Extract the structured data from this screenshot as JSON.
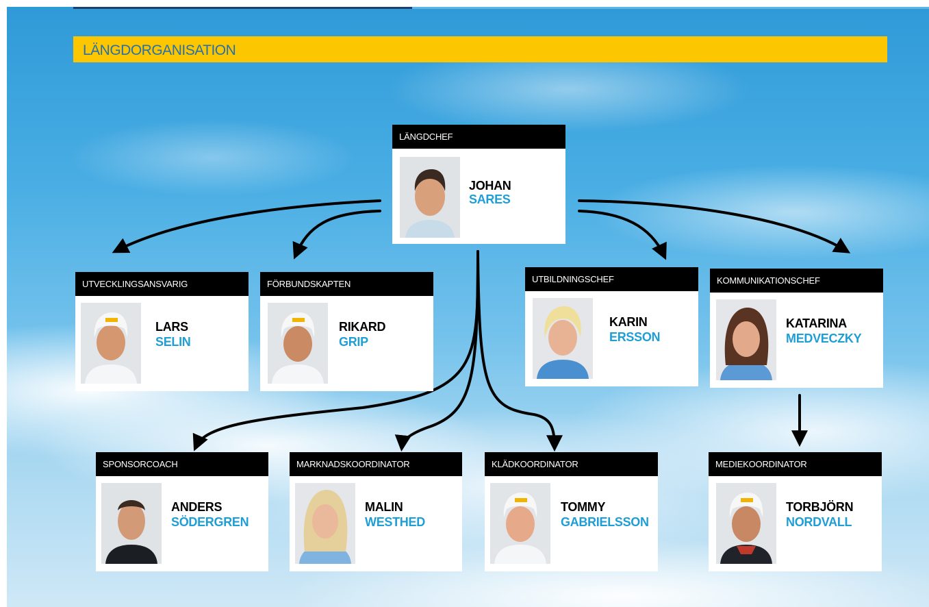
{
  "title": "LÄNGDORGANISATION",
  "colors": {
    "title_bar": "#fcc600",
    "title_text": "#2a6fa8",
    "card_header": "#000000",
    "first_name": "#000000",
    "last_name": "#1f9ed6"
  },
  "head": {
    "role": "LÄNGDCHEF",
    "first": "JOHAN",
    "last": "SARES",
    "photo": "portrait-photo"
  },
  "row1": [
    {
      "role": "UTVECKLINGSANSVARIG",
      "first": "LARS",
      "last": "SELIN",
      "photo": "portrait-photo"
    },
    {
      "role": "FÖRBUNDSKAPTEN",
      "first": "RIKARD",
      "last": "GRIP",
      "photo": "portrait-photo"
    },
    {
      "role": "UTBILDNINGSCHEF",
      "first": "KARIN",
      "last": "ERSSON",
      "photo": "portrait-photo"
    },
    {
      "role": "KOMMUNIKATIONSCHEF",
      "first": "KATARINA",
      "last": "MEDVECZKY",
      "photo": "portrait-photo"
    }
  ],
  "row2": [
    {
      "role": "SPONSORCOACH",
      "first": "ANDERS",
      "last": "SÖDERGREN",
      "photo": "portrait-photo"
    },
    {
      "role": "MARKNADSKOORDINATOR",
      "first": "MALIN",
      "last": "WESTHED",
      "photo": "portrait-photo"
    },
    {
      "role": "KLÄDKOORDINATOR",
      "first": "TOMMY",
      "last": "GABRIELSSON",
      "photo": "portrait-photo"
    },
    {
      "role": "MEDIEKOORDINATOR",
      "first": "TORBJÖRN",
      "last": "NORDVALL",
      "photo": "portrait-photo"
    }
  ],
  "edges": [
    [
      "LÄNGDCHEF",
      "UTVECKLINGSANSVARIG"
    ],
    [
      "LÄNGDCHEF",
      "FÖRBUNDSKAPTEN"
    ],
    [
      "LÄNGDCHEF",
      "UTBILDNINGSCHEF"
    ],
    [
      "LÄNGDCHEF",
      "KOMMUNIKATIONSCHEF"
    ],
    [
      "LÄNGDCHEF",
      "SPONSORCOACH"
    ],
    [
      "LÄNGDCHEF",
      "MARKNADSKOORDINATOR"
    ],
    [
      "LÄNGDCHEF",
      "KLÄDKOORDINATOR"
    ],
    [
      "KOMMUNIKATIONSCHEF",
      "MEDIEKOORDINATOR"
    ]
  ]
}
